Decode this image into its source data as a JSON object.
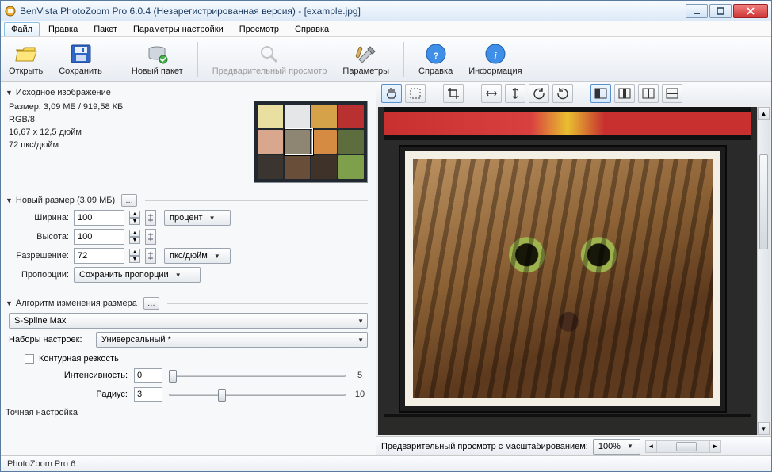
{
  "titlebar": {
    "title": "BenVista PhotoZoom Pro 6.0.4 (Незарегистрированная версия) - [example.jpg]"
  },
  "menu": {
    "file": "Файл",
    "edit": "Правка",
    "batch": "Пакет",
    "settings": "Параметры настройки",
    "view": "Просмотр",
    "help": "Справка"
  },
  "toolbar": {
    "open": "Открыть",
    "save": "Сохранить",
    "newbatch": "Новый пакет",
    "preview": "Предварительный просмотр",
    "params": "Параметры",
    "helpbtn": "Справка",
    "info": "Информация"
  },
  "src": {
    "heading": "Исходное изображение",
    "size": "Размер: 3,09 МБ / 919,58 КБ",
    "mode": "RGB/8",
    "dim": "16,67 x 12,5 дюйм",
    "res": "72 пкс/дюйм"
  },
  "newsize": {
    "heading": "Новый размер (3,09 МБ)",
    "width_lbl": "Ширина:",
    "width": "100",
    "height_lbl": "Высота:",
    "height": "100",
    "unit1": "процент",
    "res_lbl": "Разрешение:",
    "res": "72",
    "unit2": "пкс/дюйм",
    "aspect_lbl": "Пропорции:",
    "aspect": "Сохранить пропорции"
  },
  "algo": {
    "heading": "Алгоритм изменения размера",
    "method": "S-Spline Max",
    "preset_lbl": "Наборы настроек:",
    "preset": "Универсальный *",
    "sharp_chk": "Контурная резкость",
    "intensity_lbl": "Интенсивность:",
    "intensity": "0",
    "intensity_max": "5",
    "radius_lbl": "Радиус:",
    "radius": "3",
    "radius_max": "10",
    "fine_heading": "Точная настройка"
  },
  "right": {
    "preview_lbl": "Предварительный просмотр с масштабированием:",
    "zoom": "100%"
  },
  "status": {
    "text": "PhotoZoom Pro 6"
  }
}
